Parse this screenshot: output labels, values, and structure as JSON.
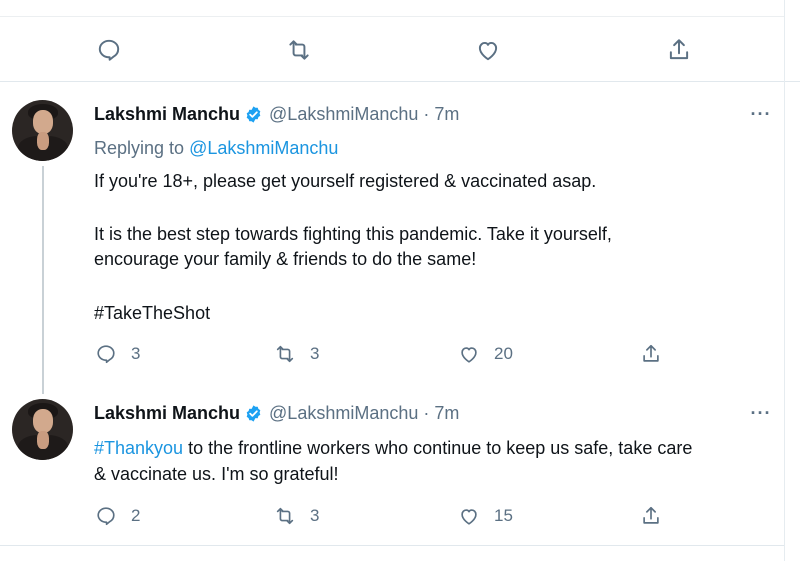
{
  "top_actions": {
    "icons": [
      "reply-icon",
      "retweet-icon",
      "like-icon",
      "share-icon"
    ]
  },
  "tweets": [
    {
      "name": "Lakshmi Manchu",
      "handle_time": "@LakshmiManchu · 7m",
      "more": "···",
      "replying_prefix": "Replying to ",
      "replying_handle": "@LakshmiManchu",
      "line1": "If you're 18+, please get yourself registered & vaccinated asap.",
      "line2": "It is the best step towards fighting this pandemic. Take it yourself,",
      "line3": "encourage your family & friends to do the same!",
      "hashtag": "#TakeTheShot",
      "replies": "3",
      "retweets": "3",
      "likes": "20"
    },
    {
      "name": "Lakshmi Manchu",
      "handle_time": "@LakshmiManchu · 7m",
      "more": "···",
      "line1_hashtag": "#Thankyou",
      "line1_rest": " to the frontline workers who continue to keep us safe, take care",
      "line2": "& vaccinate us. I'm so grateful!",
      "replies": "2",
      "retweets": "3",
      "likes": "15"
    }
  ],
  "colors": {
    "link": "#1b95e0",
    "muted": "#5b7083",
    "verified": "#1da1f2",
    "text": "#0f1419"
  }
}
